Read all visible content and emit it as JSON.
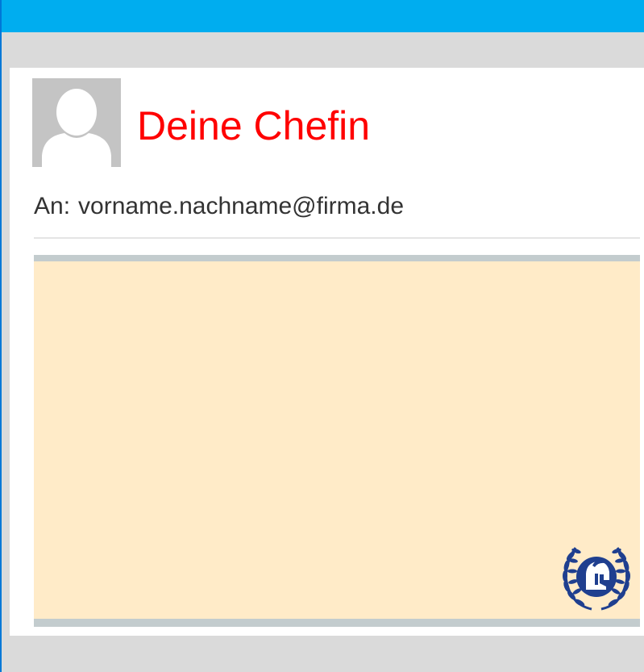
{
  "email": {
    "sender_name": "Deine Chefin",
    "to_label": "An:",
    "to_address": "vorname.nachname@firma.de"
  },
  "icons": {
    "avatar": "person-silhouette-icon",
    "emblem": "spartan-helmet-laurel-icon"
  },
  "colors": {
    "titlebar": "#00adef",
    "sender_name": "#ff0000",
    "body_background": "#ffebc8",
    "body_border": "#c3ccce",
    "emblem": "#1f3f8f"
  }
}
